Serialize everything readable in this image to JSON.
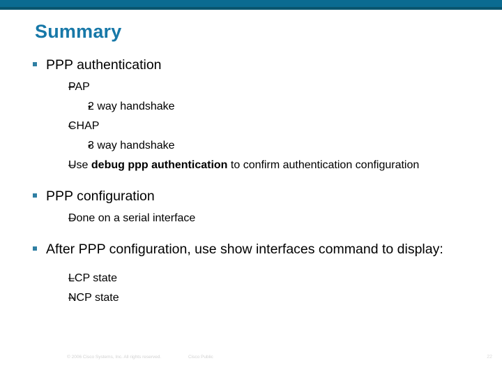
{
  "slide": {
    "title": "Summary",
    "accent_color": "#1778a8",
    "bar_color": "#0b6b91",
    "bar_shadow_color": "#0a556f",
    "bullet_color": "#2f7fa3",
    "marks": {
      "level1": "§",
      "level2": "–",
      "level3": "•"
    },
    "bullets": {
      "b1": "PPP authentication",
      "b1s1": "PAP",
      "b1s1a": "2 way handshake",
      "b1s2": "CHAP",
      "b1s2a": "3 way handshake",
      "b1s3_pre": "Use ",
      "b1s3_bold": "debug ppp authentication",
      "b1s3_post": " to confirm authentication configuration",
      "b2": "PPP configuration",
      "b2s1": "Done on a serial interface",
      "b3": "After PPP configuration, use show interfaces command to display:",
      "b3s1": "LCP state",
      "b3s2": "NCP state"
    }
  },
  "footer": {
    "copyright": "© 2006 Cisco Systems, Inc. All rights reserved.",
    "classification": "Cisco Public",
    "page_number": "22"
  }
}
